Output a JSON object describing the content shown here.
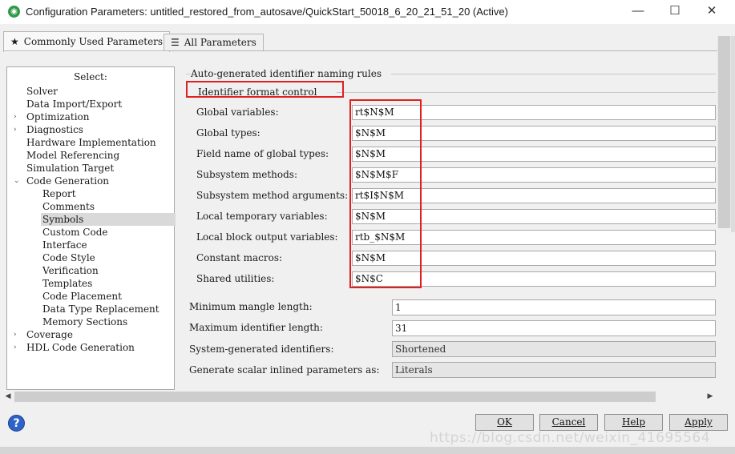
{
  "window": {
    "title": "Configuration Parameters: untitled_restored_from_autosave/QuickStart_50018_6_20_21_51_20 (Active)",
    "app_icon": "simulink-icon",
    "controls": {
      "minimize": "—",
      "maximize": "☐",
      "close": "✕"
    }
  },
  "tabs": [
    {
      "label": "Commonly Used Parameters",
      "star": "★",
      "active": true
    },
    {
      "label": "All Parameters",
      "star": "☰",
      "active": false
    }
  ],
  "tree": {
    "header": "Select:",
    "items": [
      {
        "label": "Solver"
      },
      {
        "label": "Data Import/Export"
      },
      {
        "label": "Optimization",
        "expander": "›"
      },
      {
        "label": "Diagnostics",
        "expander": "›"
      },
      {
        "label": "Hardware Implementation"
      },
      {
        "label": "Model Referencing"
      },
      {
        "label": "Simulation Target"
      },
      {
        "label": "Code Generation",
        "expander": "⌄"
      },
      {
        "label": "Report"
      },
      {
        "label": "Comments"
      },
      {
        "label": "Symbols",
        "selected": true
      },
      {
        "label": "Custom Code"
      },
      {
        "label": "Interface"
      },
      {
        "label": "Code Style"
      },
      {
        "label": "Verification"
      },
      {
        "label": "Templates"
      },
      {
        "label": "Code Placement"
      },
      {
        "label": "Data Type Replacement"
      },
      {
        "label": "Memory Sections"
      },
      {
        "label": "Coverage",
        "expander": "›"
      },
      {
        "label": "HDL Code Generation",
        "expander": "›"
      }
    ]
  },
  "panel": {
    "group_title": "Auto-generated identifier naming rules",
    "subgroup_title": "Identifier format control",
    "fields": [
      {
        "label": "Global variables:",
        "value": "rt$N$M"
      },
      {
        "label": "Global types:",
        "value": "$N$M"
      },
      {
        "label": "Field name of global types:",
        "value": "$N$M"
      },
      {
        "label": "Subsystem methods:",
        "value": "$N$M$F"
      },
      {
        "label": "Subsystem method arguments:",
        "value": "rt$I$N$M"
      },
      {
        "label": "Local temporary variables:",
        "value": "$N$M"
      },
      {
        "label": "Local block output variables:",
        "value": "rtb_$N$M"
      },
      {
        "label": "Constant macros:",
        "value": "$N$M"
      },
      {
        "label": "Shared utilities:",
        "value": "$N$C"
      }
    ],
    "lower_fields": [
      {
        "label": "Minimum mangle length:",
        "value": "1"
      },
      {
        "label": "Maximum identifier length:",
        "value": "31"
      },
      {
        "label": "System-generated identifiers:",
        "value": "Shortened"
      },
      {
        "label": "Generate scalar inlined parameters as:",
        "value": "Literals"
      }
    ]
  },
  "buttons": {
    "ok": "OK",
    "cancel": "Cancel",
    "help": "Help",
    "apply": "Apply"
  },
  "watermark": "https://blog.csdn.net/weixin_41695564",
  "colors": {
    "highlight": "#e02020",
    "selected": "#d9d9d9"
  }
}
